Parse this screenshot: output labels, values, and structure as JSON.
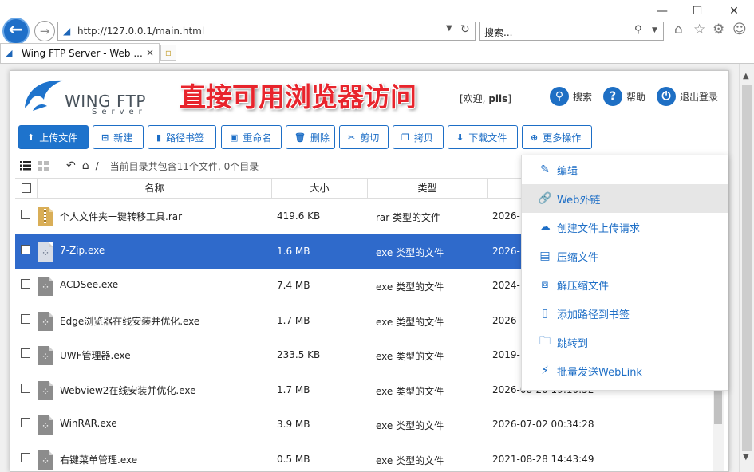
{
  "browser": {
    "url": "http://127.0.0.1/main.html",
    "search_placeholder": "搜索...",
    "tab_title": "Wing FTP Server - Web ...",
    "win_min": "—",
    "win_max": "☐",
    "win_close": "✕"
  },
  "header": {
    "brand": "WING FTP",
    "brand_sub": "Server",
    "banner": "直接可用浏览器访问",
    "welcome_prefix": "[欢迎, ",
    "username": "piis",
    "welcome_suffix": "]",
    "search_label": "搜索",
    "help_label": "帮助",
    "logout_label": "退出登录"
  },
  "toolbar": {
    "upload": "上传文件",
    "new": "新建",
    "bookmark": "路径书签",
    "rename": "重命名",
    "delete": "删除",
    "cut": "剪切",
    "copy": "拷贝",
    "download": "下载文件",
    "more": "更多操作"
  },
  "pathbar": {
    "path": "/",
    "info": "当前目录共包含11个文件, 0个目录"
  },
  "table": {
    "headers": {
      "name": "名称",
      "size": "大小",
      "type": "类型",
      "date": ""
    },
    "rows": [
      {
        "name": "个人文件夹一键转移工具.rar",
        "size": "419.6 KB",
        "type": "rar 类型的文件",
        "date": "2026-",
        "icon": "rar-icon",
        "selected": false
      },
      {
        "name": "7-Zip.exe",
        "size": "1.6 MB",
        "type": "exe 类型的文件",
        "date": "2026-",
        "icon": "exe-icon",
        "selected": true
      },
      {
        "name": "ACDSee.exe",
        "size": "7.4 MB",
        "type": "exe 类型的文件",
        "date": "2024-",
        "icon": "exe-icon",
        "selected": false
      },
      {
        "name": "Edge浏览器在线安装并优化.exe",
        "size": "1.7 MB",
        "type": "exe 类型的文件",
        "date": "2026-",
        "icon": "exe-icon",
        "selected": false
      },
      {
        "name": "UWF管理器.exe",
        "size": "233.5 KB",
        "type": "exe 类型的文件",
        "date": "2019-",
        "icon": "exe-icon",
        "selected": false
      },
      {
        "name": "Webview2在线安装并优化.exe",
        "size": "1.7 MB",
        "type": "exe 类型的文件",
        "date": "2026-08-20 19:10:52",
        "icon": "exe-icon",
        "selected": false
      },
      {
        "name": "WinRAR.exe",
        "size": "3.9 MB",
        "type": "exe 类型的文件",
        "date": "2026-07-02 00:34:28",
        "icon": "exe-icon",
        "selected": false
      },
      {
        "name": "右键菜单管理.exe",
        "size": "0.5 MB",
        "type": "exe 类型的文件",
        "date": "2021-08-28 14:43:49",
        "icon": "exe-icon",
        "selected": false
      }
    ]
  },
  "menu": {
    "items": [
      {
        "label": "编辑",
        "icon": "edit-icon",
        "glyph": "✎"
      },
      {
        "label": "Web外链",
        "icon": "link-icon",
        "glyph": "🔗"
      },
      {
        "label": "创建文件上传请求",
        "icon": "cloud-upload-icon",
        "glyph": "☁"
      },
      {
        "label": "压缩文件",
        "icon": "archive-icon",
        "glyph": "▤"
      },
      {
        "label": "解压缩文件",
        "icon": "box-open-icon",
        "glyph": "⧈"
      },
      {
        "label": "添加路径到书签",
        "icon": "bookmark-icon",
        "glyph": "▯"
      },
      {
        "label": "跳转到",
        "icon": "folder-open-icon",
        "glyph": "🗀"
      },
      {
        "label": "批量发送WebLink",
        "icon": "plug-icon",
        "glyph": "⚡"
      }
    ],
    "hover_index": 1
  },
  "colors": {
    "accent": "#1e73cc",
    "selected_row": "#2f6acb",
    "banner": "#e8242c"
  }
}
